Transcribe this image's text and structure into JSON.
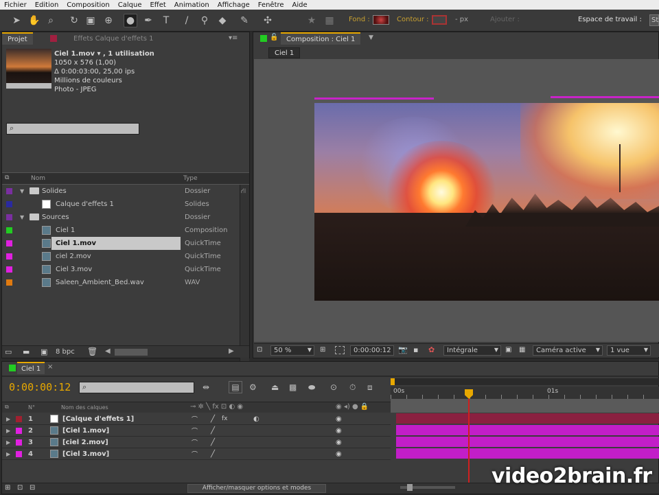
{
  "menu": [
    "Fichier",
    "Edition",
    "Composition",
    "Calque",
    "Effet",
    "Animation",
    "Affichage",
    "Fenêtre",
    "Aide"
  ],
  "toolbar": {
    "fond_label": "Fond :",
    "contour_label": "Contour :",
    "px_label": "- px",
    "ajouter_label": "Ajouter : ",
    "workspace_label": "Espace de travail :",
    "workspace_value": "St"
  },
  "project": {
    "tab_label": "Projet",
    "effects_tab_label": "Effets Calque d'effets 1",
    "item_name": "Ciel 1.mov ▾ , 1 utilisation",
    "item_size": "1050 x 576 (1,00)",
    "item_duration": "Δ 0:00:03:00, 25,00 ips",
    "item_colors": "Millions de couleurs",
    "item_codec": "Photo - JPEG",
    "search_placeholder": "",
    "col_name": "Nom",
    "col_type": "Type",
    "items": [
      {
        "indent": 0,
        "folder": true,
        "open": true,
        "name": "Solides",
        "type": "Dossier",
        "color": "#7a2fa0"
      },
      {
        "indent": 1,
        "folder": false,
        "name": "Calque d'effets 1",
        "type": "Solides",
        "color": "#2a2aa0",
        "icon": "solid-icon"
      },
      {
        "indent": 0,
        "folder": true,
        "open": true,
        "name": "Sources",
        "type": "Dossier",
        "color": "#7a2fa0"
      },
      {
        "indent": 1,
        "folder": false,
        "name": "Ciel 1",
        "type": "Composition",
        "color": "#22cc22",
        "icon": "composition-icon"
      },
      {
        "indent": 1,
        "folder": false,
        "name": "Ciel 1.mov",
        "type": "QuickTime",
        "color": "#e020e0",
        "icon": "quicktime-icon",
        "selected": true
      },
      {
        "indent": 1,
        "folder": false,
        "name": "ciel 2.mov",
        "type": "QuickTime",
        "color": "#e020e0",
        "icon": "quicktime-icon"
      },
      {
        "indent": 1,
        "folder": false,
        "name": "Ciel 3.mov",
        "type": "QuickTime",
        "color": "#e020e0",
        "icon": "quicktime-icon"
      },
      {
        "indent": 1,
        "folder": false,
        "name": "Saleen_Ambient_Bed.wav",
        "type": "WAV",
        "color": "#e07a10",
        "icon": "audio-file-icon"
      }
    ],
    "bpc": "8 bpc"
  },
  "composition": {
    "tab_label": "Composition : Ciel 1",
    "crumb": "Ciel 1",
    "zoom": "50 %",
    "timecode": "0:00:00:12",
    "resolution": "Intégrale",
    "camera": "Caméra active",
    "views": "1 vue"
  },
  "timeline": {
    "tab_label": "Ciel 1",
    "timecode": "0:00:00:12",
    "col_num": "N°",
    "col_name": "Nom des calques",
    "ruler": [
      "00s",
      "01s"
    ],
    "toggle_label": "Afficher/masquer options et modes",
    "layers": [
      {
        "num": "1",
        "name": "[Calque d'effets 1]",
        "color": "#a02030",
        "swatch": "#ffffff",
        "barcolor": "#8a2040"
      },
      {
        "num": "2",
        "name": "[Ciel 1.mov]",
        "color": "#e020e0",
        "swatch": "quicktime",
        "barcolor": "#c21ec8"
      },
      {
        "num": "3",
        "name": "[ciel 2.mov]",
        "color": "#e020e0",
        "swatch": "quicktime",
        "barcolor": "#c21ec8"
      },
      {
        "num": "4",
        "name": "[Ciel 3.mov]",
        "color": "#e020e0",
        "swatch": "quicktime",
        "barcolor": "#c21ec8"
      }
    ]
  },
  "watermark": "video2brain.fr",
  "colors": {
    "timecode": "#e8a800",
    "accent_green": "#22cc22",
    "magenta": "#e020e0"
  }
}
